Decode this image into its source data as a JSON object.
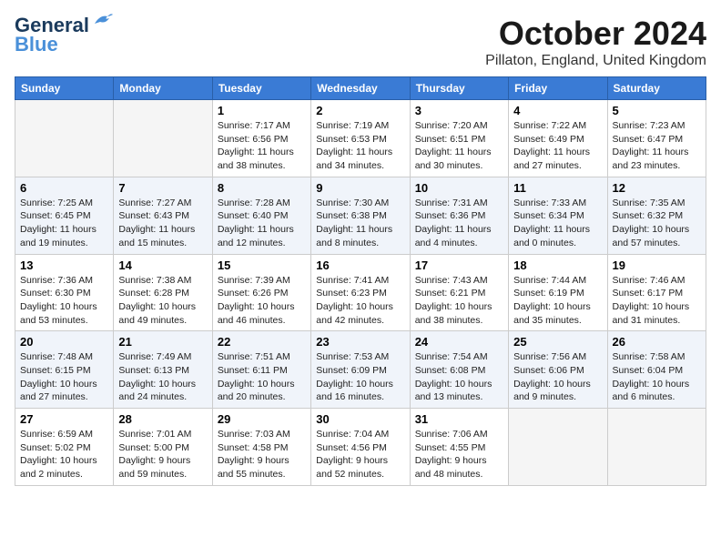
{
  "logo": {
    "line1": "General",
    "line2": "Blue"
  },
  "title": "October 2024",
  "location": "Pillaton, England, United Kingdom",
  "days_of_week": [
    "Sunday",
    "Monday",
    "Tuesday",
    "Wednesday",
    "Thursday",
    "Friday",
    "Saturday"
  ],
  "weeks": [
    [
      {
        "day": "",
        "info": ""
      },
      {
        "day": "",
        "info": ""
      },
      {
        "day": "1",
        "info": "Sunrise: 7:17 AM\nSunset: 6:56 PM\nDaylight: 11 hours and 38 minutes."
      },
      {
        "day": "2",
        "info": "Sunrise: 7:19 AM\nSunset: 6:53 PM\nDaylight: 11 hours and 34 minutes."
      },
      {
        "day": "3",
        "info": "Sunrise: 7:20 AM\nSunset: 6:51 PM\nDaylight: 11 hours and 30 minutes."
      },
      {
        "day": "4",
        "info": "Sunrise: 7:22 AM\nSunset: 6:49 PM\nDaylight: 11 hours and 27 minutes."
      },
      {
        "day": "5",
        "info": "Sunrise: 7:23 AM\nSunset: 6:47 PM\nDaylight: 11 hours and 23 minutes."
      }
    ],
    [
      {
        "day": "6",
        "info": "Sunrise: 7:25 AM\nSunset: 6:45 PM\nDaylight: 11 hours and 19 minutes."
      },
      {
        "day": "7",
        "info": "Sunrise: 7:27 AM\nSunset: 6:43 PM\nDaylight: 11 hours and 15 minutes."
      },
      {
        "day": "8",
        "info": "Sunrise: 7:28 AM\nSunset: 6:40 PM\nDaylight: 11 hours and 12 minutes."
      },
      {
        "day": "9",
        "info": "Sunrise: 7:30 AM\nSunset: 6:38 PM\nDaylight: 11 hours and 8 minutes."
      },
      {
        "day": "10",
        "info": "Sunrise: 7:31 AM\nSunset: 6:36 PM\nDaylight: 11 hours and 4 minutes."
      },
      {
        "day": "11",
        "info": "Sunrise: 7:33 AM\nSunset: 6:34 PM\nDaylight: 11 hours and 0 minutes."
      },
      {
        "day": "12",
        "info": "Sunrise: 7:35 AM\nSunset: 6:32 PM\nDaylight: 10 hours and 57 minutes."
      }
    ],
    [
      {
        "day": "13",
        "info": "Sunrise: 7:36 AM\nSunset: 6:30 PM\nDaylight: 10 hours and 53 minutes."
      },
      {
        "day": "14",
        "info": "Sunrise: 7:38 AM\nSunset: 6:28 PM\nDaylight: 10 hours and 49 minutes."
      },
      {
        "day": "15",
        "info": "Sunrise: 7:39 AM\nSunset: 6:26 PM\nDaylight: 10 hours and 46 minutes."
      },
      {
        "day": "16",
        "info": "Sunrise: 7:41 AM\nSunset: 6:23 PM\nDaylight: 10 hours and 42 minutes."
      },
      {
        "day": "17",
        "info": "Sunrise: 7:43 AM\nSunset: 6:21 PM\nDaylight: 10 hours and 38 minutes."
      },
      {
        "day": "18",
        "info": "Sunrise: 7:44 AM\nSunset: 6:19 PM\nDaylight: 10 hours and 35 minutes."
      },
      {
        "day": "19",
        "info": "Sunrise: 7:46 AM\nSunset: 6:17 PM\nDaylight: 10 hours and 31 minutes."
      }
    ],
    [
      {
        "day": "20",
        "info": "Sunrise: 7:48 AM\nSunset: 6:15 PM\nDaylight: 10 hours and 27 minutes."
      },
      {
        "day": "21",
        "info": "Sunrise: 7:49 AM\nSunset: 6:13 PM\nDaylight: 10 hours and 24 minutes."
      },
      {
        "day": "22",
        "info": "Sunrise: 7:51 AM\nSunset: 6:11 PM\nDaylight: 10 hours and 20 minutes."
      },
      {
        "day": "23",
        "info": "Sunrise: 7:53 AM\nSunset: 6:09 PM\nDaylight: 10 hours and 16 minutes."
      },
      {
        "day": "24",
        "info": "Sunrise: 7:54 AM\nSunset: 6:08 PM\nDaylight: 10 hours and 13 minutes."
      },
      {
        "day": "25",
        "info": "Sunrise: 7:56 AM\nSunset: 6:06 PM\nDaylight: 10 hours and 9 minutes."
      },
      {
        "day": "26",
        "info": "Sunrise: 7:58 AM\nSunset: 6:04 PM\nDaylight: 10 hours and 6 minutes."
      }
    ],
    [
      {
        "day": "27",
        "info": "Sunrise: 6:59 AM\nSunset: 5:02 PM\nDaylight: 10 hours and 2 minutes."
      },
      {
        "day": "28",
        "info": "Sunrise: 7:01 AM\nSunset: 5:00 PM\nDaylight: 9 hours and 59 minutes."
      },
      {
        "day": "29",
        "info": "Sunrise: 7:03 AM\nSunset: 4:58 PM\nDaylight: 9 hours and 55 minutes."
      },
      {
        "day": "30",
        "info": "Sunrise: 7:04 AM\nSunset: 4:56 PM\nDaylight: 9 hours and 52 minutes."
      },
      {
        "day": "31",
        "info": "Sunrise: 7:06 AM\nSunset: 4:55 PM\nDaylight: 9 hours and 48 minutes."
      },
      {
        "day": "",
        "info": ""
      },
      {
        "day": "",
        "info": ""
      }
    ]
  ]
}
